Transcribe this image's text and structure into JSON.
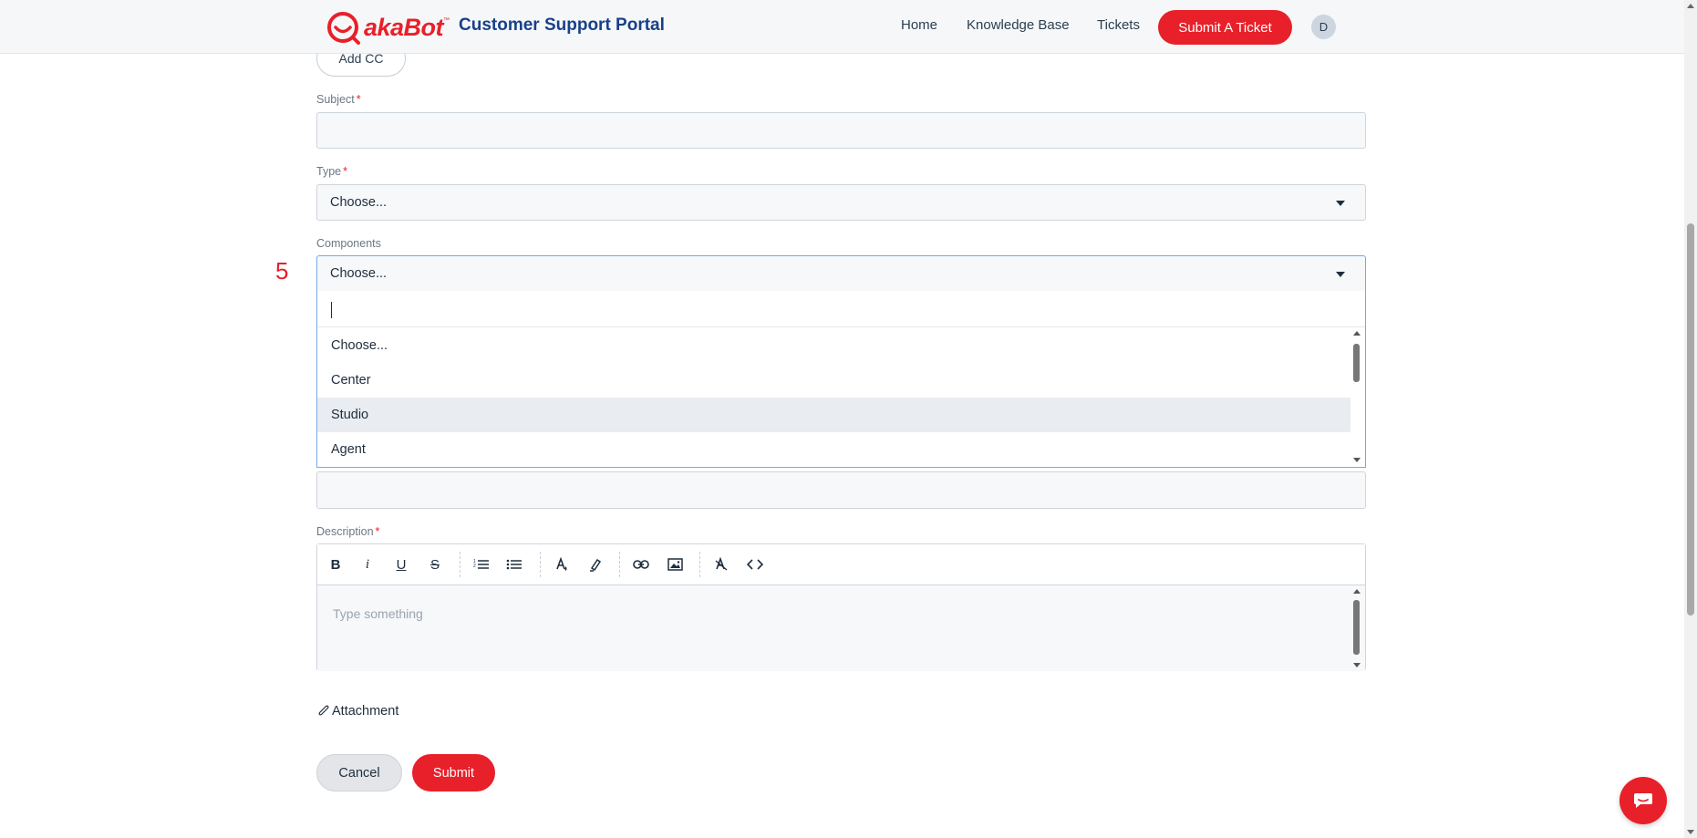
{
  "header": {
    "logo_text": "akaBot",
    "logo_tm": "™",
    "portal_title": "Customer Support Portal",
    "nav": [
      "Home",
      "Knowledge Base",
      "Tickets"
    ],
    "submit_ticket_label": "Submit A Ticket",
    "avatar_initial": "D",
    "brand_color": "#e8202a"
  },
  "form": {
    "add_cc_label": "Add CC",
    "subject": {
      "label": "Subject",
      "required_mark": "*",
      "value": ""
    },
    "type": {
      "label": "Type",
      "required_mark": "*",
      "selected": "Choose..."
    },
    "components": {
      "label": "Components",
      "selected": "Choose...",
      "search_value": "",
      "options": [
        "Choose...",
        "Center",
        "Studio",
        "Agent"
      ],
      "hovered_option": "Studio"
    },
    "step_number": "5",
    "description": {
      "label": "Description",
      "required_mark": "*",
      "placeholder": "Type something",
      "toolbar_icons": [
        "bold-icon",
        "italic-icon",
        "underline-icon",
        "strikethrough-icon",
        "ordered-list-icon",
        "bullet-list-icon",
        "text-color-icon",
        "highlight-icon",
        "link-icon",
        "image-icon",
        "clear-format-icon",
        "code-icon"
      ]
    },
    "attachment_label": "Attachment",
    "cancel_label": "Cancel",
    "submit_label": "Submit"
  }
}
